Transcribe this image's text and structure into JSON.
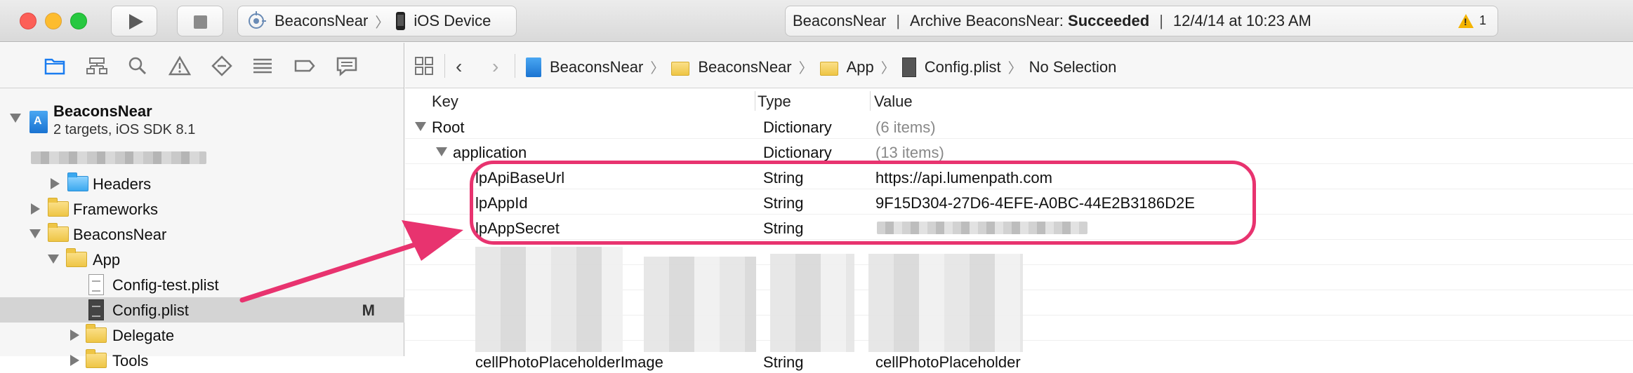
{
  "toolbar": {
    "scheme_project": "BeaconsNear",
    "scheme_destination": "iOS Device",
    "activity": {
      "project": "BeaconsNear",
      "action_prefix": "Archive BeaconsNear: ",
      "action_status": "Succeeded",
      "timestamp": "12/4/14 at 10:23 AM",
      "separator": "|"
    },
    "warning_count": "1"
  },
  "navigator": {
    "tabs": [
      "folder-icon",
      "hierarchy-icon",
      "search-icon",
      "warning-icon",
      "test-icon",
      "debug-icon",
      "breakpoint-icon",
      "log-icon"
    ],
    "project": {
      "name": "BeaconsNear",
      "subtitle": "2 targets, iOS SDK 8.1"
    },
    "items": [
      {
        "label": "Headers"
      },
      {
        "label": "Frameworks"
      },
      {
        "label": "BeaconsNear"
      },
      {
        "label": "App"
      },
      {
        "label": "Config-test.plist"
      },
      {
        "label": "Config.plist",
        "badge": "M"
      },
      {
        "label": "Delegate"
      },
      {
        "label": "Tools"
      }
    ]
  },
  "jumpbar": {
    "crumbs": [
      "BeaconsNear",
      "BeaconsNear",
      "App",
      "Config.plist",
      "No Selection"
    ]
  },
  "plist": {
    "headers": {
      "key": "Key",
      "type": "Type",
      "value": "Value"
    },
    "rows": [
      {
        "key": "Root",
        "type": "Dictionary",
        "value": "(6 items)"
      },
      {
        "key": "application",
        "type": "Dictionary",
        "value": "(13 items)"
      },
      {
        "key": "lpApiBaseUrl",
        "type": "String",
        "value": "https://api.lumenpath.com"
      },
      {
        "key": "lpAppId",
        "type": "String",
        "value": "9F15D304-27D6-4EFE-A0BC-44E2B3186D2E"
      },
      {
        "key": "lpAppSecret",
        "type": "String",
        "value": ""
      }
    ],
    "partial_row": {
      "key": "cellPhotoPlaceholderImage",
      "type": "String",
      "value": "cellPhotoPlaceholder"
    }
  },
  "colors": {
    "highlight": "#e8336f",
    "folder": "#eec545",
    "selection": "#d4d4d4"
  }
}
